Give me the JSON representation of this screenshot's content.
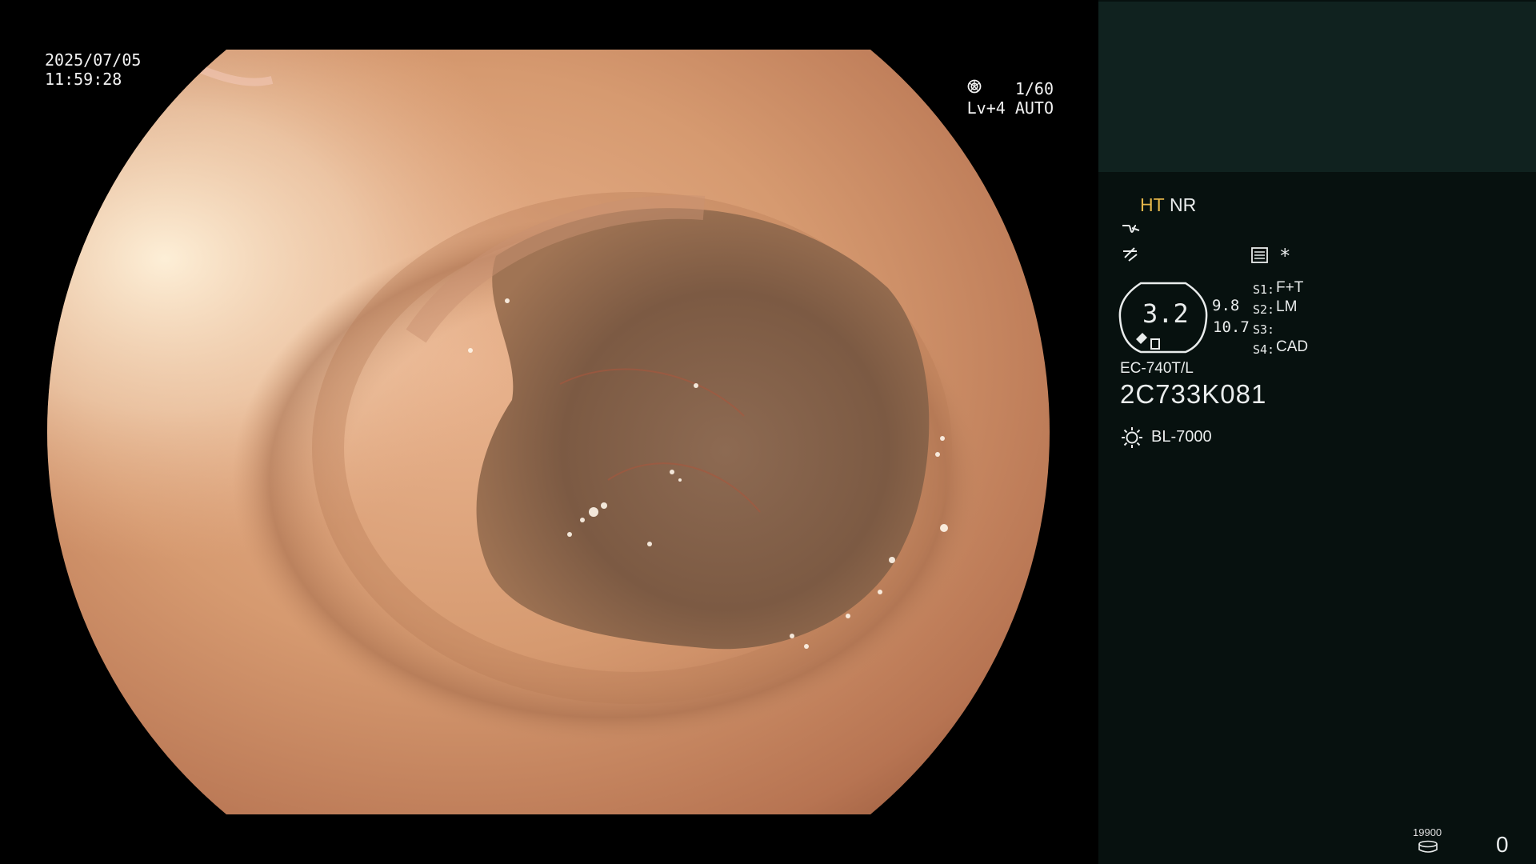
{
  "image": {
    "date": "2025/07/05",
    "time": "11:59:28",
    "shutter": "1/60",
    "level": "Lv+4 AUTO",
    "shutter_icon": "aperture-icon",
    "auto_icon": "auto-exposure-icon"
  },
  "panel": {
    "mode_ht": "HT",
    "mode_nr": "NR",
    "ht_color": "#e6b74a",
    "structure_icon": "structure-enhancement-icon",
    "color_icon": "color-enhancement-icon",
    "memo_icon": "memo-icon",
    "asterisk": "*",
    "zoom": "3.2",
    "value_a": "9.8",
    "value_b": "10.7",
    "switches": [
      {
        "label": "S1:",
        "value": "F+T"
      },
      {
        "label": "S2:",
        "value": "LM"
      },
      {
        "label": "S3:",
        "value": ""
      },
      {
        "label": "S4:",
        "value": "CAD"
      }
    ],
    "scope_model": "EC-740T/L",
    "serial": "2C733K081",
    "light_icon": "light-source-icon",
    "light_source": "BL-7000",
    "counter_small": "19900",
    "disk_icon": "disk-icon",
    "counter": "0"
  },
  "colors": {
    "panel_bg": "#07110f",
    "panel_top_bg": "#10221f"
  }
}
